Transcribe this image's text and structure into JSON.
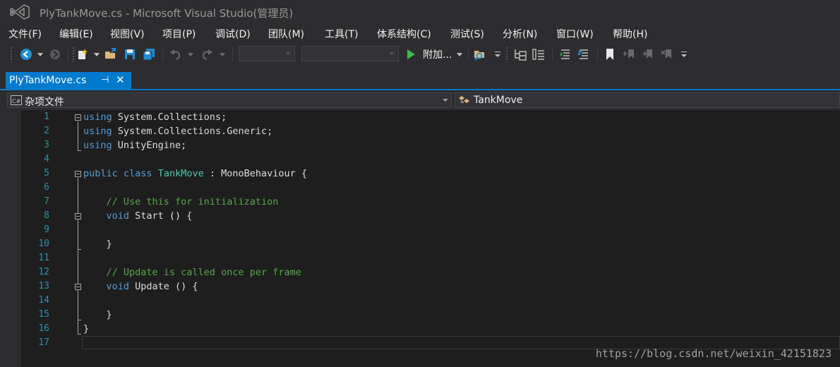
{
  "window": {
    "title": "PlyTankMove.cs - Microsoft Visual Studio(管理员)",
    "logo_icon": "visual-studio-logo-icon"
  },
  "menu": [
    {
      "label": "文件(F)"
    },
    {
      "label": "编辑(E)"
    },
    {
      "label": "视图(V)"
    },
    {
      "label": "项目(P)"
    },
    {
      "label": "调试(D)"
    },
    {
      "label": "团队(M)"
    },
    {
      "label": "工具(T)"
    },
    {
      "label": "体系结构(C)"
    },
    {
      "label": "测试(S)"
    },
    {
      "label": "分析(N)"
    },
    {
      "label": "窗口(W)"
    },
    {
      "label": "帮助(H)"
    }
  ],
  "toolbar": {
    "attach_label": "附加...",
    "config_value": "",
    "platform_value": ""
  },
  "tab": {
    "label": "PlyTankMove.cs",
    "pin_glyph": "⊣",
    "close_glyph": "✕"
  },
  "navigation": {
    "project_label": "杂项文件",
    "project_icon": "csharp-file-icon",
    "class_label": "TankMove",
    "class_icon": "class-icon"
  },
  "editor": {
    "line_numbers": [
      "1",
      "2",
      "3",
      "4",
      "5",
      "6",
      "7",
      "8",
      "9",
      "10",
      "11",
      "12",
      "13",
      "14",
      "15",
      "16",
      "17"
    ],
    "lines": [
      [
        {
          "t": "using",
          "c": "kw"
        },
        {
          "t": " System.Collections;",
          "c": ""
        }
      ],
      [
        {
          "t": "using",
          "c": "kw"
        },
        {
          "t": " System.Collections.Generic;",
          "c": ""
        }
      ],
      [
        {
          "t": "using",
          "c": "kw"
        },
        {
          "t": " UnityEngine;",
          "c": ""
        }
      ],
      [],
      [
        {
          "t": "public",
          "c": "kw"
        },
        {
          "t": " ",
          "c": ""
        },
        {
          "t": "class",
          "c": "kw"
        },
        {
          "t": " ",
          "c": ""
        },
        {
          "t": "TankMove",
          "c": "ty"
        },
        {
          "t": " : MonoBehaviour {",
          "c": ""
        }
      ],
      [],
      [
        {
          "t": "    // Use this for initialization",
          "c": "cm"
        }
      ],
      [
        {
          "t": "    ",
          "c": ""
        },
        {
          "t": "void",
          "c": "kw"
        },
        {
          "t": " Start () {",
          "c": ""
        }
      ],
      [
        {
          "t": "        ",
          "c": ""
        }
      ],
      [
        {
          "t": "    }",
          "c": ""
        }
      ],
      [],
      [
        {
          "t": "    // Update is called once per frame",
          "c": "cm"
        }
      ],
      [
        {
          "t": "    ",
          "c": ""
        },
        {
          "t": "void",
          "c": "kw"
        },
        {
          "t": " Update () {",
          "c": ""
        }
      ],
      [
        {
          "t": "        ",
          "c": ""
        }
      ],
      [
        {
          "t": "    }",
          "c": ""
        }
      ],
      [
        {
          "t": "}",
          "c": ""
        }
      ],
      []
    ]
  },
  "watermark": "https://blog.csdn.net/weixin_42151823",
  "colors": {
    "accent": "#007acc",
    "keyword": "#569cd6",
    "type": "#4ec9b0",
    "comment": "#57a64a",
    "line_number": "#2b91af"
  }
}
